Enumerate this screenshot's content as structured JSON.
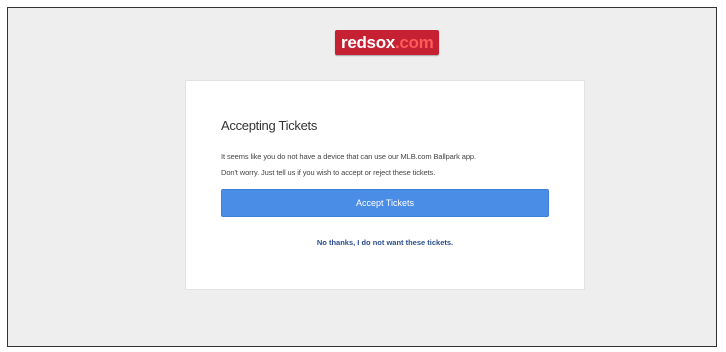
{
  "logo": {
    "name": "redsox",
    "domain": ".com"
  },
  "card": {
    "title": "Accepting Tickets",
    "message_line1": "It seems like you do not have a device that can use our MLB.com Ballpark app.",
    "message_line2": "Don't worry. Just tell us if you wish to accept or reject these tickets.",
    "accept_label": "Accept Tickets",
    "decline_label": "No thanks, I do not want these tickets."
  },
  "colors": {
    "brand_red": "#c62033",
    "button_blue": "#4a8de6",
    "link_blue": "#2b4f8c",
    "page_background": "#eeeeee"
  }
}
